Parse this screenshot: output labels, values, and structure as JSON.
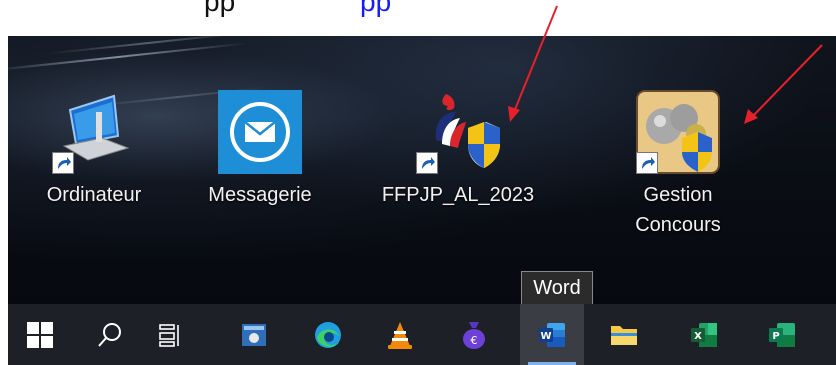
{
  "header": {
    "text_black": "pp",
    "text_blue": "pp"
  },
  "desktop": {
    "icons": [
      {
        "label": "Ordinateur"
      },
      {
        "label": "Messagerie"
      },
      {
        "label": "FFPJP_AL_2023"
      },
      {
        "label_line1": "Gestion",
        "label_line2": "Concours"
      }
    ]
  },
  "taskbar": {
    "tooltip": "Word",
    "items": [
      "start",
      "search",
      "task-view",
      "app-blue-window",
      "edge",
      "vlc",
      "app-purple-bag",
      "word",
      "file-explorer",
      "excel",
      "project"
    ]
  },
  "colors": {
    "taskbar": "#1d2027",
    "highlight": "#7fb3e8",
    "arrow": "#e8202a",
    "header_blue": "#1a1aff"
  }
}
